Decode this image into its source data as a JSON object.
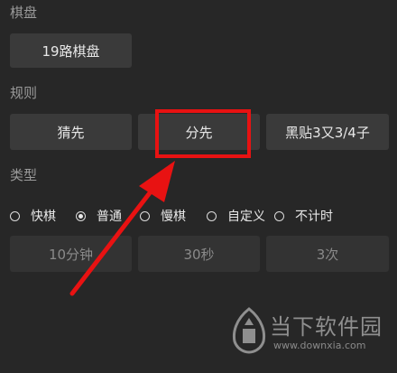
{
  "sections": {
    "board_label": "棋盘",
    "rules_label": "规则",
    "type_label": "类型"
  },
  "board": {
    "option": "19路棋盘"
  },
  "rules": {
    "options": [
      "猜先",
      "分先",
      "黑贴3又3/4子"
    ],
    "highlighted": "分先"
  },
  "type": {
    "options": [
      {
        "label": "快棋",
        "checked": false
      },
      {
        "label": "普通",
        "checked": true
      },
      {
        "label": "慢棋",
        "checked": false
      },
      {
        "label": "自定义",
        "checked": false
      },
      {
        "label": "不计时",
        "checked": false
      }
    ]
  },
  "time_settings": {
    "values": [
      "10分钟",
      "30秒",
      "3次"
    ]
  },
  "watermark": {
    "title": "当下软件园",
    "url": "www.downxia.com"
  },
  "colors": {
    "background": "#272727",
    "button": "#3a3a3a",
    "highlight": "#e81212"
  }
}
